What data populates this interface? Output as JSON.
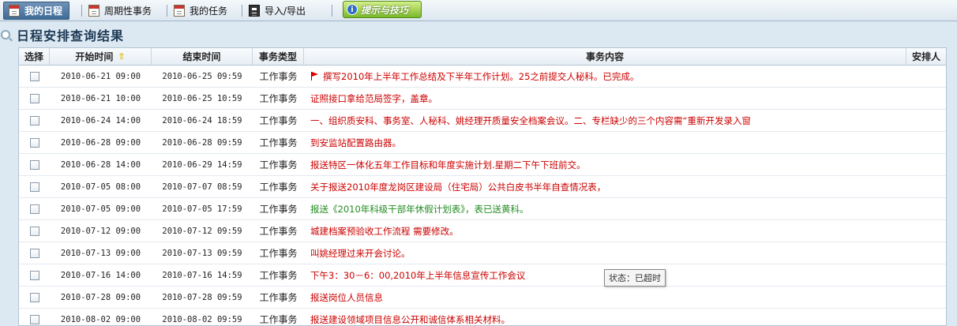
{
  "tabs": [
    {
      "label": "我的日程",
      "icon": "calendar-icon"
    },
    {
      "label": "周期性事务",
      "icon": "calendar-icon"
    },
    {
      "label": "我的任务",
      "icon": "calendar-icon"
    },
    {
      "label": "导入/导出",
      "icon": "import-export-icon"
    }
  ],
  "tips_button": {
    "label": "提示与技巧",
    "icon": "info-icon"
  },
  "page_title": "日程安排查询结果",
  "columns": {
    "select": "选择",
    "start": "开始时间",
    "end": "结束时间",
    "type": "事务类型",
    "content": "事务内容",
    "arranger": "安排人"
  },
  "rows": [
    {
      "start": "2010-06-21 09:00",
      "end": "2010-06-25 09:59",
      "type": "工作事务",
      "content": "撰写2010年上半年工作总结及下半年工作计划。25之前提交人秘科。已完成。",
      "color": "#cc0000",
      "flag": true
    },
    {
      "start": "2010-06-21 10:00",
      "end": "2010-06-25 10:59",
      "type": "工作事务",
      "content": "证照接口拿给范局签字，盖章。",
      "color": "#cc0000",
      "flag": false
    },
    {
      "start": "2010-06-24 14:00",
      "end": "2010-06-24 18:59",
      "type": "工作事务",
      "content": "一、组织质安科、事务室、人秘科、姚经理开质量安全档案会议。二、专栏缺少的三个内容需“重新开发录入窗",
      "color": "#cc0000",
      "flag": false
    },
    {
      "start": "2010-06-28 09:00",
      "end": "2010-06-28 09:59",
      "type": "工作事务",
      "content": "到安监站配置路由器。",
      "color": "#cc0000",
      "flag": false
    },
    {
      "start": "2010-06-28 14:00",
      "end": "2010-06-29 14:59",
      "type": "工作事务",
      "content": "报送特区一体化五年工作目标和年度实施计划.星期二下午下班前交。",
      "color": "#cc0000",
      "flag": false
    },
    {
      "start": "2010-07-05 08:00",
      "end": "2010-07-07 08:59",
      "type": "工作事务",
      "content": "关于报送2010年度龙岗区建设局（住宅局）公共白皮书半年自查情况表，",
      "color": "#cc0000",
      "flag": false
    },
    {
      "start": "2010-07-05 09:00",
      "end": "2010-07-05 17:59",
      "type": "工作事务",
      "content": "报送《2010年科级干部年休假计划表》，表已送黄科。",
      "color": "#228b22",
      "flag": false
    },
    {
      "start": "2010-07-12 09:00",
      "end": "2010-07-12 09:59",
      "type": "工作事务",
      "content": "城建档案预验收工作流程 需要修改。",
      "color": "#cc0000",
      "flag": false
    },
    {
      "start": "2010-07-13 09:00",
      "end": "2010-07-13 09:59",
      "type": "工作事务",
      "content": "叫姚经理过来开会讨论。",
      "color": "#cc0000",
      "flag": false
    },
    {
      "start": "2010-07-16 14:00",
      "end": "2010-07-16 14:59",
      "type": "工作事务",
      "content": "下午3：30－6：00,2010年上半年信息宣传工作会议",
      "color": "#cc0000",
      "flag": false
    },
    {
      "start": "2010-07-28 09:00",
      "end": "2010-07-28 09:59",
      "type": "工作事务",
      "content": "报送岗位人员信息",
      "color": "#cc0000",
      "flag": false
    },
    {
      "start": "2010-08-02 09:00",
      "end": "2010-08-02 09:59",
      "type": "工作事务",
      "content": "报送建设领域项目信息公开和诚信体系相关材料。",
      "color": "#cc0000",
      "flag": false
    }
  ],
  "tooltip": "状态：已超时"
}
